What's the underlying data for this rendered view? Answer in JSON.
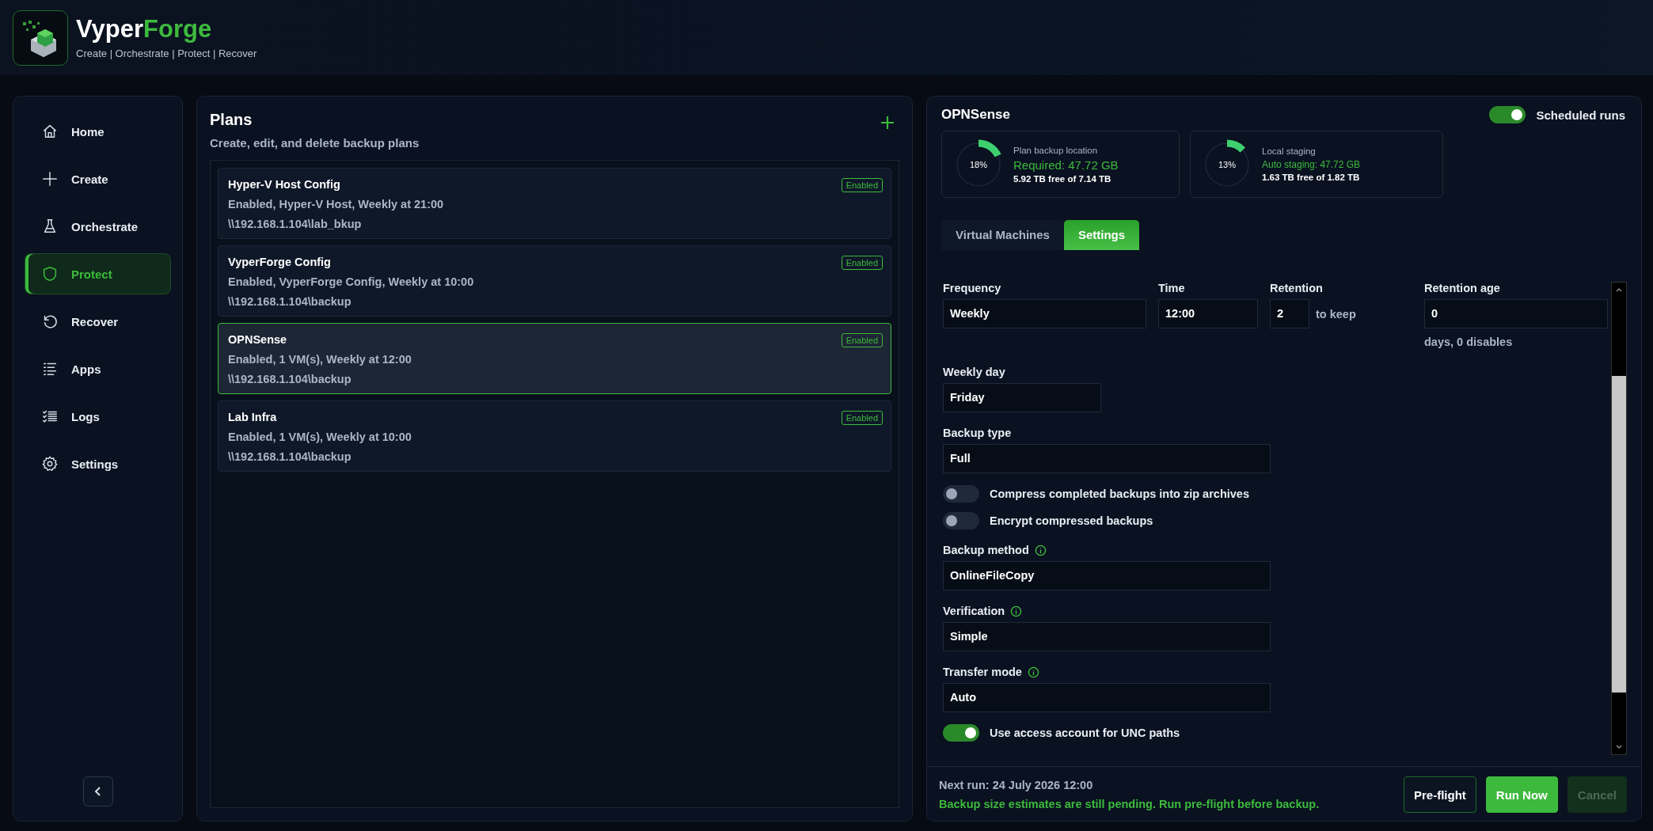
{
  "app": {
    "name_first": "Vyper",
    "name_second": "Forge",
    "tagline": "Create | Orchestrate | Protect | Recover"
  },
  "sidebar": {
    "items": [
      {
        "label": "Home",
        "kind": "home",
        "selected": false
      },
      {
        "label": "Create",
        "kind": "plus",
        "selected": false
      },
      {
        "label": "Orchestrate",
        "kind": "flask",
        "selected": false
      },
      {
        "label": "Protect",
        "kind": "shield",
        "selected": true
      },
      {
        "label": "Recover",
        "kind": "restore",
        "selected": false
      },
      {
        "label": "Apps",
        "kind": "list",
        "selected": false
      },
      {
        "label": "Logs",
        "kind": "checklist",
        "selected": false
      },
      {
        "label": "Settings",
        "kind": "gear",
        "selected": false
      }
    ]
  },
  "plans": {
    "title": "Plans",
    "subtitle": "Create, edit, and delete backup plans",
    "items": [
      {
        "name": "Hyper-V Host Config",
        "summary": "Enabled, Hyper-V Host, Weekly at 21:00",
        "path": "\\\\192.168.1.104\\lab_bkup",
        "badge": "Enabled",
        "selected": false
      },
      {
        "name": "VyperForge Config",
        "summary": "Enabled, VyperForge Config, Weekly at 10:00",
        "path": "\\\\192.168.1.104\\backup",
        "badge": "Enabled",
        "selected": false
      },
      {
        "name": "OPNSense",
        "summary": "Enabled, 1 VM(s), Weekly at 12:00",
        "path": "\\\\192.168.1.104\\backup",
        "badge": "Enabled",
        "selected": true
      },
      {
        "name": "Lab Infra",
        "summary": "Enabled, 1 VM(s), Weekly at 10:00",
        "path": "\\\\192.168.1.104\\backup",
        "badge": "Enabled",
        "selected": false
      }
    ]
  },
  "details": {
    "title": "OPNSense",
    "scheduled_runs": {
      "label": "Scheduled runs",
      "on": true
    },
    "storage": [
      {
        "title": "Plan backup location",
        "percent": "18%",
        "level": 0.18,
        "primary": "Required: 47.72 GB",
        "secondary": "5.92 TB free of 7.14 TB",
        "kind": "large"
      },
      {
        "title": "Local staging",
        "percent": "13%",
        "level": 0.13,
        "primary": "Auto staging: 47.72 GB",
        "secondary": "1.63 TB free of 1.82 TB",
        "kind": "small"
      }
    ],
    "tabs": [
      {
        "label": "Virtual Machines",
        "selected": false
      },
      {
        "label": "Settings",
        "selected": true
      }
    ],
    "top_row": [
      {
        "label": "Frequency",
        "value": "Weekly"
      },
      {
        "label": "Time",
        "value": "12:00"
      },
      {
        "label": "Retention",
        "value": "2",
        "suffix": "to keep"
      },
      {
        "label": "Retention age",
        "value": "0",
        "hint": "days, 0 disables"
      }
    ],
    "items": [
      {
        "kind": "short-field",
        "label": "Weekly day",
        "value": "Friday",
        "info": false
      },
      {
        "kind": "field",
        "label": "Backup type",
        "value": "Full",
        "info": false
      },
      {
        "kind": "toggle",
        "label": "Compress completed backups into zip archives",
        "on": false
      },
      {
        "kind": "toggle",
        "label": "Encrypt compressed backups",
        "on": false
      },
      {
        "kind": "field",
        "label": "Backup method",
        "value": "OnlineFileCopy",
        "info": true
      },
      {
        "kind": "field",
        "label": "Verification",
        "value": "Simple",
        "info": true
      },
      {
        "kind": "field",
        "label": "Transfer mode",
        "value": "Auto",
        "info": true
      },
      {
        "kind": "toggle",
        "label": "Use access account for UNC paths",
        "on": true
      }
    ],
    "next_run": "Next run: 24 July 2026 12:00",
    "message": "Backup size estimates are still pending. Run pre-flight before backup.",
    "buttons": [
      {
        "label": "Pre-flight",
        "kind": "secondary",
        "disabled": false
      },
      {
        "label": "Run Now",
        "kind": "primary",
        "disabled": false
      },
      {
        "label": "Cancel",
        "kind": "primary",
        "disabled": true
      }
    ]
  }
}
